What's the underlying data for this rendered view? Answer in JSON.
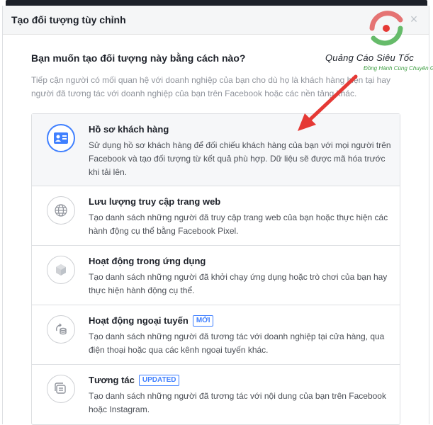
{
  "dialog": {
    "title": "Tạo đối tượng tùy chỉnh",
    "close_label": "×"
  },
  "question": "Bạn muốn tạo đối tượng này bằng cách nào?",
  "description": "Tiếp cận người có mối quan hệ với doanh nghiệp của bạn cho dù họ là khách hàng hiện tại hay người đã tương tác với doanh nghiệp của bạn trên Facebook hoặc các nền tảng khác.",
  "options": [
    {
      "title": "Hồ sơ khách hàng",
      "badge": "",
      "description": "Sử dụng hồ sơ khách hàng để đối chiếu khách hàng của bạn với mọi người trên Facebook và tạo đối tượng từ kết quả phù hợp. Dữ liệu sẽ được mã hóa trước khi tải lên.",
      "icon": "customer-file-icon",
      "selected": true
    },
    {
      "title": "Lưu lượng truy cập trang web",
      "badge": "",
      "description": "Tạo danh sách những người đã truy cập trang web của bạn hoặc thực hiện các hành động cụ thể bằng Facebook Pixel.",
      "icon": "globe-icon",
      "selected": false
    },
    {
      "title": "Hoạt động trong ứng dụng",
      "badge": "",
      "description": "Tạo danh sách những người đã khởi chạy ứng dụng hoặc trò chơi của bạn hay thực hiện hành động cụ thể.",
      "icon": "app-cube-icon",
      "selected": false
    },
    {
      "title": "Hoạt động ngoại tuyến",
      "badge": "MỚI",
      "description": "Tạo danh sách những người đã tương tác với doanh nghiệp tại cửa hàng, qua điện thoại hoặc qua các kênh ngoại tuyến khác.",
      "icon": "offline-activity-icon",
      "selected": false
    },
    {
      "title": "Tương tác",
      "badge": "UPDATED",
      "description": "Tạo danh sách những người đã tương tác với nội dung của bạn trên Facebook hoặc Instagram.",
      "icon": "engagement-icon",
      "selected": false
    }
  ],
  "watermark": {
    "name": "Quảng Cáo Siêu Tốc",
    "tagline": "Đồng Hành Cùng Chuyên Gia"
  },
  "colors": {
    "accent": "#4080ff",
    "arrow": "#e53935",
    "header_bg": "#f5f6f7"
  }
}
